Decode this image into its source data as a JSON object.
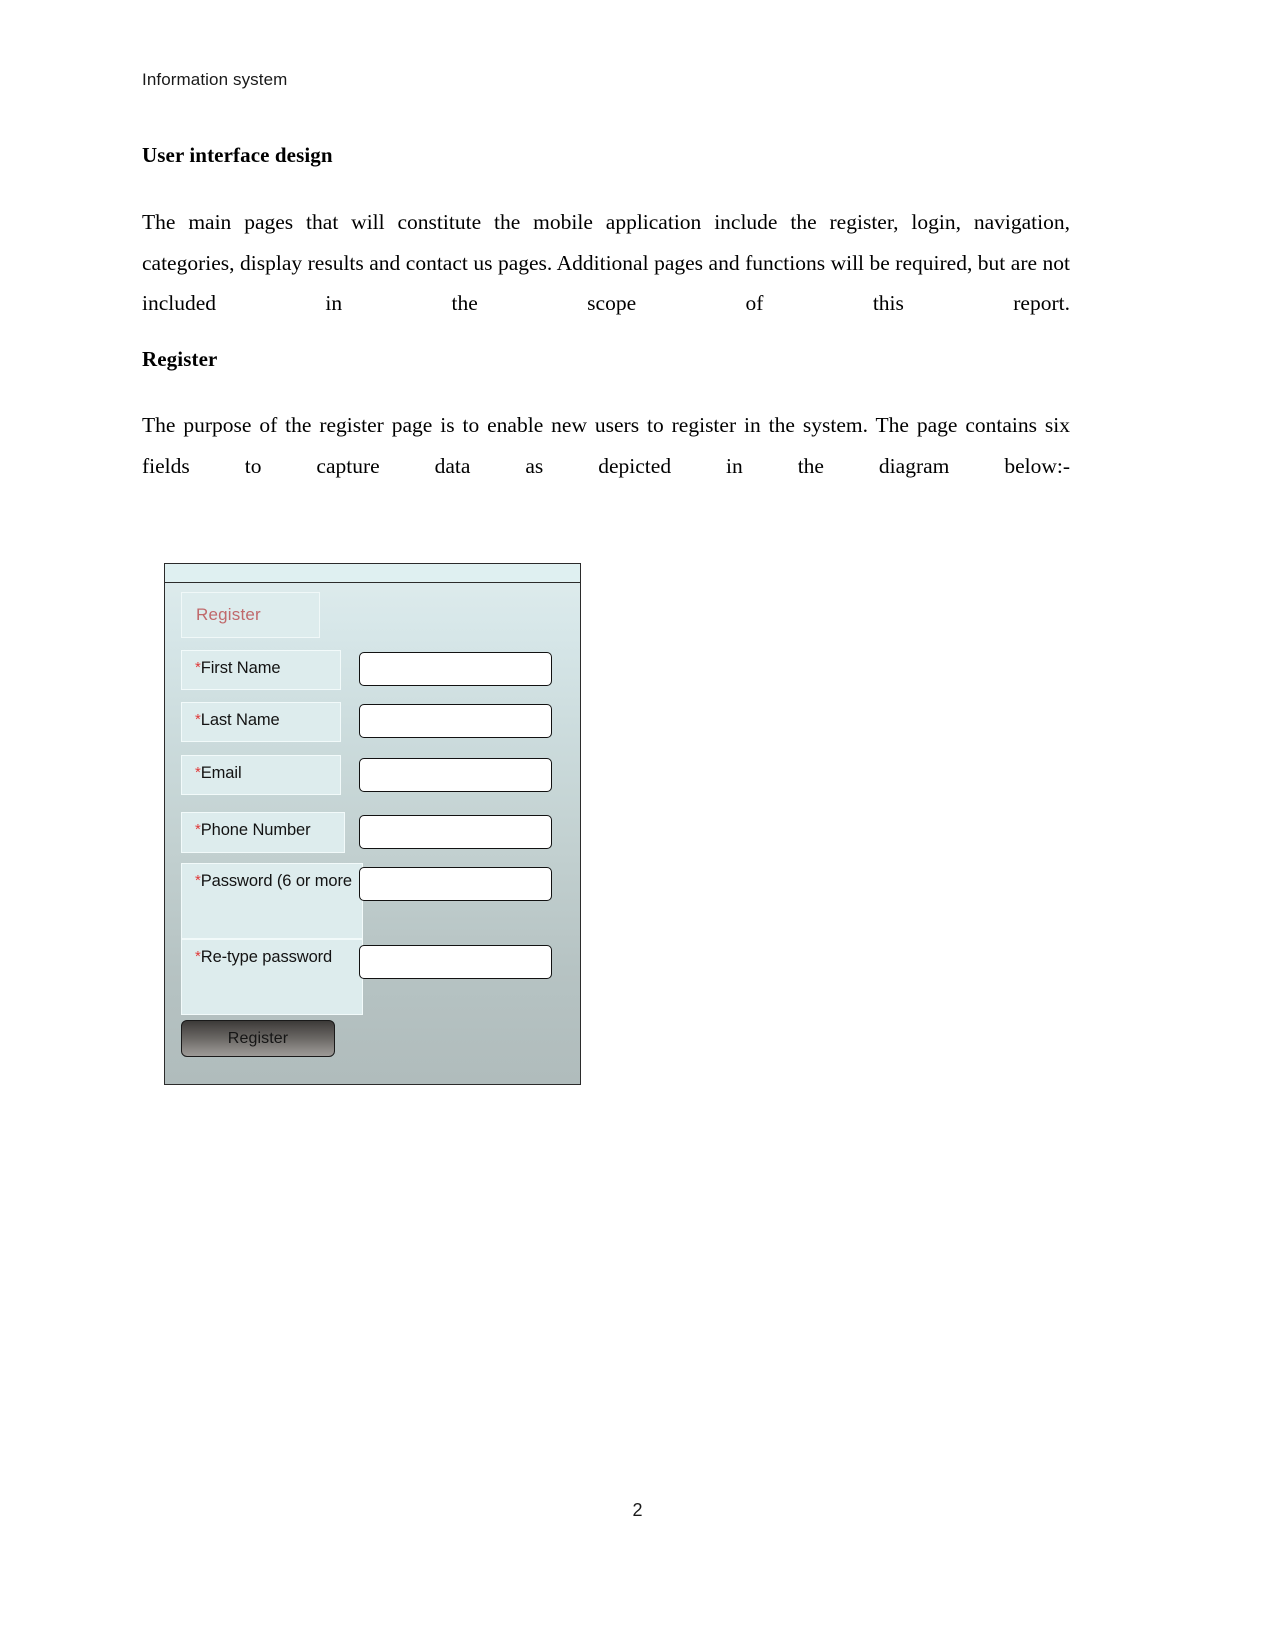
{
  "document": {
    "running_header": "Information system",
    "page_number": "2",
    "sections": [
      {
        "heading": "User interface design",
        "body": "The main pages that will constitute the mobile application include the register, login, navigation, categories, display results and contact us pages. Additional pages and functions will be required, but are not included in the scope of this report."
      },
      {
        "heading": "Register",
        "body": "The purpose of the register page is to enable new users to register in the system. The page contains six fields to capture data as depicted in the diagram below:-"
      }
    ]
  },
  "mockup": {
    "title": "Register",
    "title_color": "#c0696b",
    "required_marker": "*",
    "submit_label": "Register",
    "fields": [
      {
        "label": "First Name",
        "value": "",
        "required": true
      },
      {
        "label": "Last Name",
        "value": "",
        "required": true
      },
      {
        "label": "Email",
        "value": "",
        "required": true
      },
      {
        "label": "Phone Number",
        "value": "",
        "required": true
      },
      {
        "label": "Password (6 or more",
        "value": "",
        "required": true
      },
      {
        "label": "Re-type password",
        "value": "",
        "required": true
      }
    ]
  }
}
